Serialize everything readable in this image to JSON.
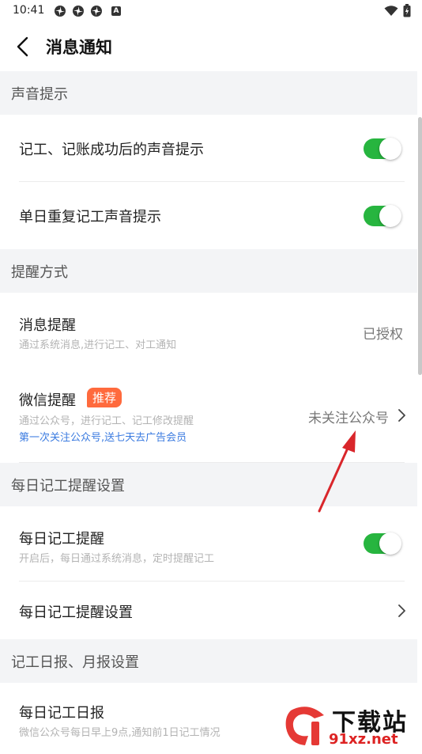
{
  "status_bar": {
    "time": "10:41",
    "icons": [
      "pinwheel-icon",
      "pinwheel-icon",
      "pinwheel-icon",
      "a-notification-icon"
    ],
    "right_icons": [
      "wifi-icon",
      "battery-icon"
    ]
  },
  "header": {
    "title": "消息通知",
    "back_icon": "chevron-left-icon"
  },
  "sections": {
    "sound": {
      "title": "声音提示",
      "items": [
        {
          "title": "记工、记账成功后的声音提示",
          "toggle": true
        },
        {
          "title": "单日重复记工声音提示",
          "toggle": true
        }
      ]
    },
    "remind": {
      "title": "提醒方式",
      "message": {
        "title": "消息提醒",
        "sub": "通过系统消息,进行记工、对工通知",
        "value": "已授权"
      },
      "wechat": {
        "title": "微信提醒",
        "badge": "推荐",
        "sub": "通过公众号，进行记工、记工修改提醒",
        "link": "第一次关注公众号,送七天去广告会员",
        "value": "未关注公众号"
      }
    },
    "daily": {
      "title": "每日记工提醒设置",
      "remind": {
        "title": "每日记工提醒",
        "sub": "开启后，每日通过系统消息，定时提醒记工",
        "toggle": true
      },
      "settings": {
        "title": "每日记工提醒设置"
      }
    },
    "report": {
      "title": "记工日报、月报设置",
      "daily": {
        "title": "每日记工日报",
        "sub": "微信公众号每日早上9点,通知前1日记工情况"
      }
    }
  },
  "watermark": {
    "top_text": "下载站",
    "bottom_text": "91xz.net"
  },
  "colors": {
    "toggle_on": "#27b53f",
    "badge": "#ff6a3d",
    "link": "#3b7be0",
    "section_bg": "#f3f4f6",
    "arrow": "#d9262b"
  }
}
